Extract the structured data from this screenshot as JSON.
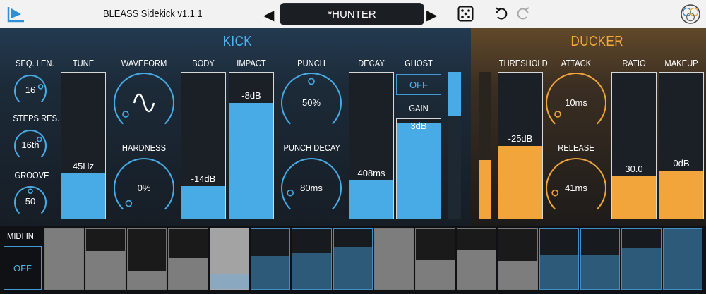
{
  "header": {
    "title": "BLEASS Sidekick  v1.1.1",
    "preset_name": "*HUNTER",
    "prev_glyph": "◀",
    "next_glyph": "▶",
    "icons": [
      "bleass-logo-icon",
      "dice-icon",
      "undo-icon",
      "redo-icon",
      "brand-circle-icon"
    ]
  },
  "kick": {
    "title": "KICK",
    "seq_len": {
      "label": "SEQ. LEN.",
      "value": "16",
      "level": 0.75
    },
    "steps_res": {
      "label": "STEPS RES.",
      "value": "16th",
      "level": 0.7
    },
    "groove": {
      "label": "GROOVE",
      "value": "50",
      "level": 0.5
    },
    "tune": {
      "label": "TUNE",
      "value": "45Hz",
      "level": 0.31
    },
    "waveform": {
      "label": "WAVEFORM",
      "level": 0.05
    },
    "hardness": {
      "label": "HARDNESS",
      "value": "0%",
      "level": 0.0
    },
    "body": {
      "label": "BODY",
      "value": "-14dB",
      "level": 0.22
    },
    "impact": {
      "label": "IMPACT",
      "value": "-8dB",
      "level": 0.79
    },
    "punch": {
      "label": "PUNCH",
      "value": "50%",
      "level": 0.5
    },
    "punch_decay": {
      "label": "PUNCH DECAY",
      "value": "80ms",
      "level": 0.12
    },
    "decay": {
      "label": "DECAY",
      "value": "408ms",
      "level": 0.26
    },
    "ghost": {
      "label": "GHOST",
      "button": "OFF"
    },
    "gain": {
      "label": "GAIN",
      "value": "3dB",
      "level": 0.96
    },
    "meter_level": 0.3
  },
  "ducker": {
    "title": "DUCKER",
    "threshold": {
      "label": "THRESHOLD",
      "value": "-25dB",
      "level": 0.5
    },
    "attack": {
      "label": "ATTACK",
      "value": "10ms",
      "level": 0.05
    },
    "release": {
      "label": "RELEASE",
      "value": "41ms",
      "level": 0.12
    },
    "ratio": {
      "label": "RATIO",
      "value": "30.0",
      "level": 0.29
    },
    "makeup": {
      "label": "MAKEUP",
      "value": "0dB",
      "level": 0.33
    },
    "meter_level": 0.4
  },
  "bottom": {
    "midi_label": "MIDI IN",
    "midi_button": "OFF",
    "steps": [
      {
        "level": 1.0,
        "color": "grey"
      },
      {
        "level": 0.63,
        "color": "grey"
      },
      {
        "level": 0.3,
        "color": "grey"
      },
      {
        "level": 0.52,
        "color": "grey"
      },
      {
        "level": 1.0,
        "color": "grey",
        "active": true
      },
      {
        "level": 0.55,
        "color": "blue"
      },
      {
        "level": 0.6,
        "color": "blue"
      },
      {
        "level": 0.7,
        "color": "blue"
      },
      {
        "level": 1.0,
        "color": "grey"
      },
      {
        "level": 0.48,
        "color": "grey"
      },
      {
        "level": 0.66,
        "color": "grey"
      },
      {
        "level": 0.47,
        "color": "grey"
      },
      {
        "level": 0.58,
        "color": "blue"
      },
      {
        "level": 0.58,
        "color": "blue"
      },
      {
        "level": 0.68,
        "color": "blue"
      },
      {
        "level": 1.0,
        "color": "blue"
      }
    ]
  },
  "colors": {
    "kick_accent": "#48abe6",
    "ducker_accent": "#f2a53a"
  }
}
